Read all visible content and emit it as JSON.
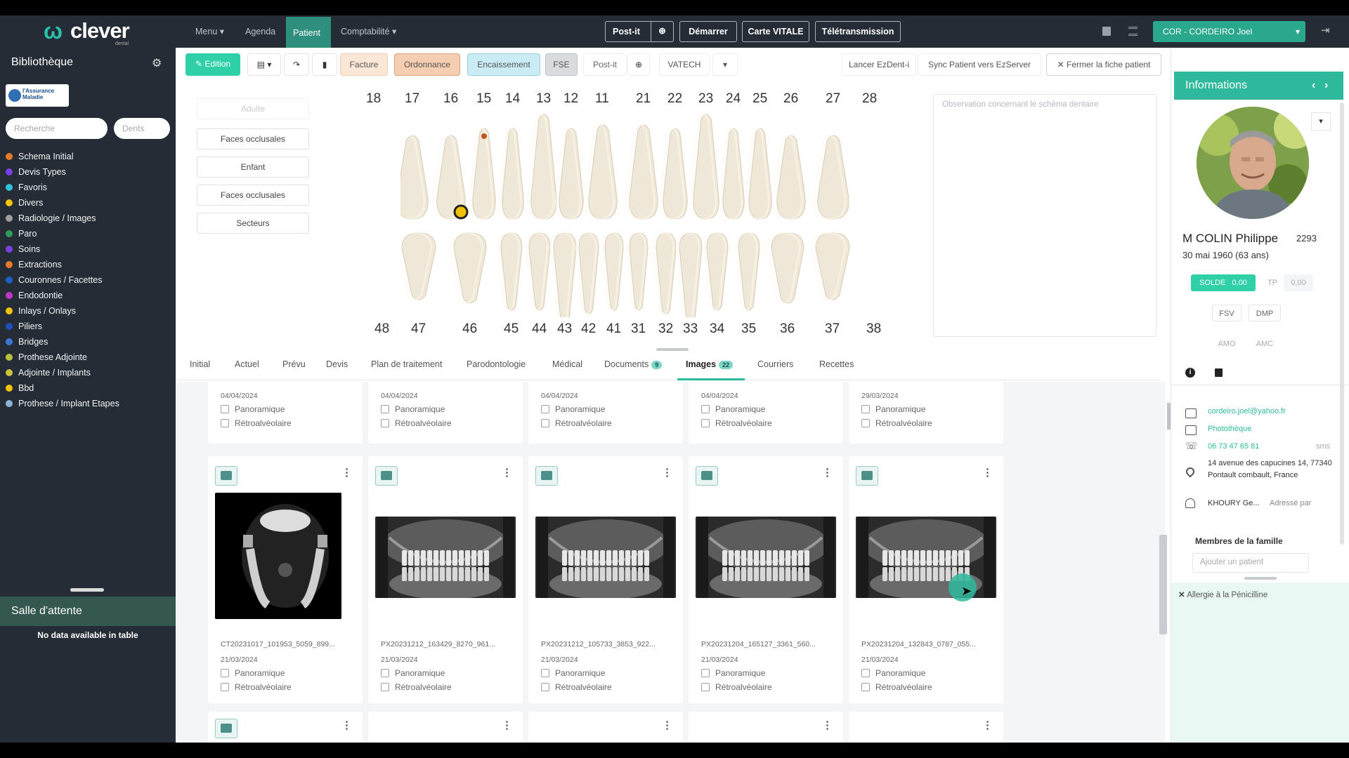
{
  "topbar": {
    "logo_text": "clever",
    "logo_sub": "dental",
    "nav": [
      {
        "label": "Menu",
        "caret": "▾"
      },
      {
        "label": "Agenda"
      },
      {
        "label": "Patient"
      },
      {
        "label": "Comptabilité",
        "caret": "▾"
      }
    ],
    "buttons": {
      "postit": "Post-it",
      "demarrer": "Démarrer",
      "carte_vitale": "Carte VITALE",
      "teletransmission": "Télétransmission"
    },
    "user": "COR - CORDEIRO Joel"
  },
  "sidebar": {
    "title": "Bibliothèque",
    "badge": "l'Assurance Maladie",
    "search_placeholder": "Recherche",
    "dents_placeholder": "Dents",
    "items": [
      {
        "label": "Schema Initial",
        "color": "#e8792b"
      },
      {
        "label": "Devis Types",
        "color": "#7b3fe4"
      },
      {
        "label": "Favoris",
        "color": "#2fc1d8"
      },
      {
        "label": "Divers",
        "color": "#f1c40f"
      },
      {
        "label": "Radiologie / Images",
        "color": "#9e9e9e"
      },
      {
        "label": "Paro",
        "color": "#2e9e58"
      },
      {
        "label": "Soins",
        "color": "#7b3fe4"
      },
      {
        "label": "Extractions",
        "color": "#e8792b"
      },
      {
        "label": "Couronnes / Facettes",
        "color": "#1f5fbf"
      },
      {
        "label": "Endodontie",
        "color": "#c036c9"
      },
      {
        "label": "Inlays / Onlays",
        "color": "#f1c40f"
      },
      {
        "label": "Piliers",
        "color": "#1f4fbf"
      },
      {
        "label": "Bridges",
        "color": "#3a78d8"
      },
      {
        "label": "Prothese Adjointe",
        "color": "#b7c23a"
      },
      {
        "label": "Adjointe / Implants",
        "color": "#c9c23a"
      },
      {
        "label": "Bbd",
        "color": "#f1c40f"
      },
      {
        "label": "Prothese / Implant Etapes",
        "color": "#8fb2d8"
      }
    ],
    "waiting_room_title": "Salle d'attente",
    "waiting_room_empty": "No data available in table"
  },
  "toolbar": {
    "edition": "Edition",
    "facture": "Facture",
    "ordonnance": "Ordonnance",
    "encaissement": "Encaissement",
    "fse": "FSE",
    "postit": "Post-it",
    "vatech": "VATECH",
    "lancer": "Lancer EzDent-i",
    "sync": "Sync Patient vers EzServer",
    "fermer": "✕ Fermer la fiche patient"
  },
  "dental_chart": {
    "left_buttons": [
      "Faces occlusales",
      "Enfant",
      "Faces occlusales",
      "Secteurs"
    ],
    "upper_numbers": [
      "18",
      "17",
      "16",
      "15",
      "14",
      "13",
      "12",
      "11",
      "21",
      "22",
      "23",
      "24",
      "25",
      "26",
      "27",
      "28"
    ],
    "lower_numbers": [
      "48",
      "47",
      "46",
      "45",
      "44",
      "43",
      "42",
      "41",
      "31",
      "32",
      "33",
      "34",
      "35",
      "36",
      "37",
      "38"
    ],
    "observation_placeholder": "Observation concernant le schéma dentaire"
  },
  "tabs": [
    {
      "label": "Initial"
    },
    {
      "label": "Actuel"
    },
    {
      "label": "Prévu"
    },
    {
      "label": "Devis"
    },
    {
      "label": "Plan de traitement"
    },
    {
      "label": "Parodontologie"
    },
    {
      "label": "Médical"
    },
    {
      "label": "Documents",
      "badge": "9"
    },
    {
      "label": "Images",
      "badge": "22",
      "active": true
    },
    {
      "label": "Courriers"
    },
    {
      "label": "Recettes"
    }
  ],
  "image_cards_top": [
    {
      "date": "04/04/2024"
    },
    {
      "date": "04/04/2024"
    },
    {
      "date": "04/04/2024"
    },
    {
      "date": "04/04/2024"
    },
    {
      "date": "29/03/2024"
    }
  ],
  "image_cards": [
    {
      "filename": "CT20231017_101953_5059_899...",
      "date": "21/03/2024",
      "kind": "ct"
    },
    {
      "filename": "PX20231212_163429_8270_961...",
      "date": "21/03/2024",
      "kind": "pano"
    },
    {
      "filename": "PX20231212_105733_3853_922...",
      "date": "21/03/2024",
      "kind": "pano"
    },
    {
      "filename": "PX20231204_165127_3361_560...",
      "date": "21/03/2024",
      "kind": "pano"
    },
    {
      "filename": "PX20231204_132843_0787_055...",
      "date": "21/03/2024",
      "kind": "pano"
    }
  ],
  "checkbox_labels": {
    "panoramique": "Panoramique",
    "retro": "Rétroalvéolaire"
  },
  "patient": {
    "panel_title": "Informations",
    "name": "M COLIN Philippe",
    "id": "2293",
    "dob": "30 mai 1960 (63 ans)",
    "solde_label": "SOLDE",
    "solde_value": "0,00",
    "tp_label": "TP",
    "tp_value": "0,00",
    "fsv": "FSV",
    "dmp": "DMP",
    "amo": "AMO",
    "amc": "AMC",
    "email": "cordeiro.joel@yahoo.fr",
    "phototheque": "Photothèque",
    "phone": "06 73 47 65 81",
    "sms": "sms",
    "address": "14 avenue des capucines 14, 77340 Pontault combault, France",
    "referrer": "KHOURY Ge...",
    "referrer_label": "Adressé par",
    "family_title": "Membres de la famille",
    "family_placeholder": "Ajouter un patient",
    "allergy": "Allergie à la Pénicilline"
  }
}
